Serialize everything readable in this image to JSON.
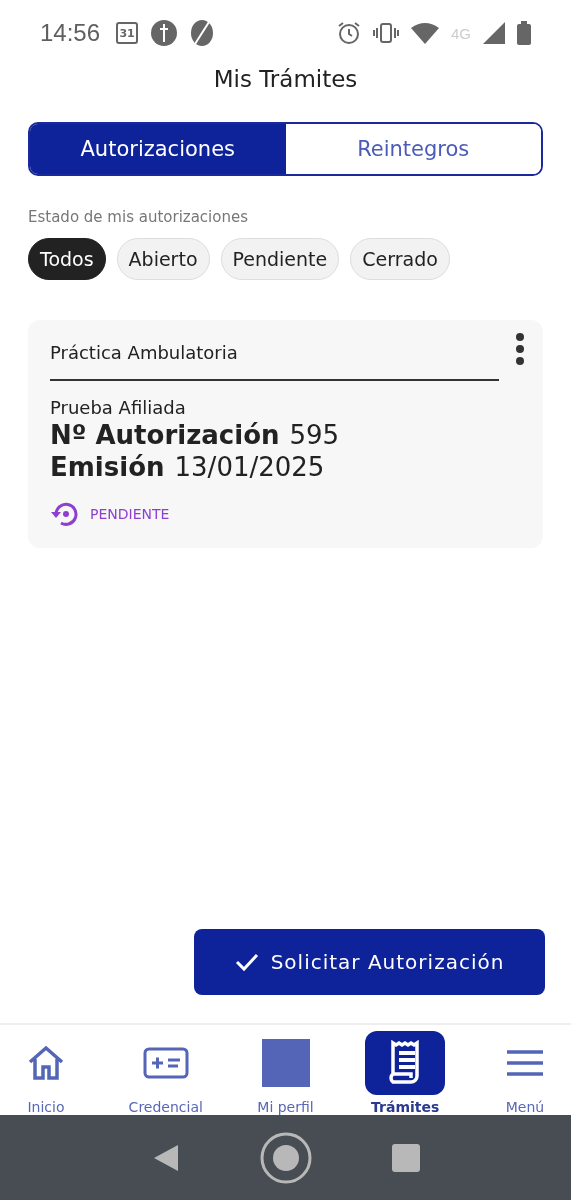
{
  "status_bar": {
    "time": "14:56",
    "calendar_day": "31",
    "network": "4G"
  },
  "title": "Mis Trámites",
  "tabs": [
    {
      "label": "Autorizaciones",
      "selected": true
    },
    {
      "label": "Reintegros",
      "selected": false
    }
  ],
  "filter_label": "Estado de mis autorizaciones",
  "filters": [
    {
      "label": "Todos",
      "selected": true
    },
    {
      "label": "Abierto",
      "selected": false
    },
    {
      "label": "Pendiente",
      "selected": false
    },
    {
      "label": "Cerrado",
      "selected": false
    }
  ],
  "cards": [
    {
      "title": "Práctica Ambulatoria",
      "affiliate": "Prueba Afiliada",
      "number_label": "Nº Autorización",
      "number": "595",
      "date_label": "Emisión",
      "date": "13/01/2025",
      "status": "PENDIENTE",
      "color": "#8e3fd0"
    }
  ],
  "action_button": "Solicitar Autorización",
  "bottom_nav": [
    {
      "kind": "home",
      "label": "Inicio",
      "selected": false
    },
    {
      "kind": "card",
      "label": "Credencial",
      "selected": false
    },
    {
      "kind": "avatar",
      "label": "Mi perfil",
      "selected": false
    },
    {
      "kind": "receipt",
      "label": "Trámites",
      "selected": true
    },
    {
      "kind": "menu",
      "label": "Menú",
      "selected": false
    }
  ]
}
